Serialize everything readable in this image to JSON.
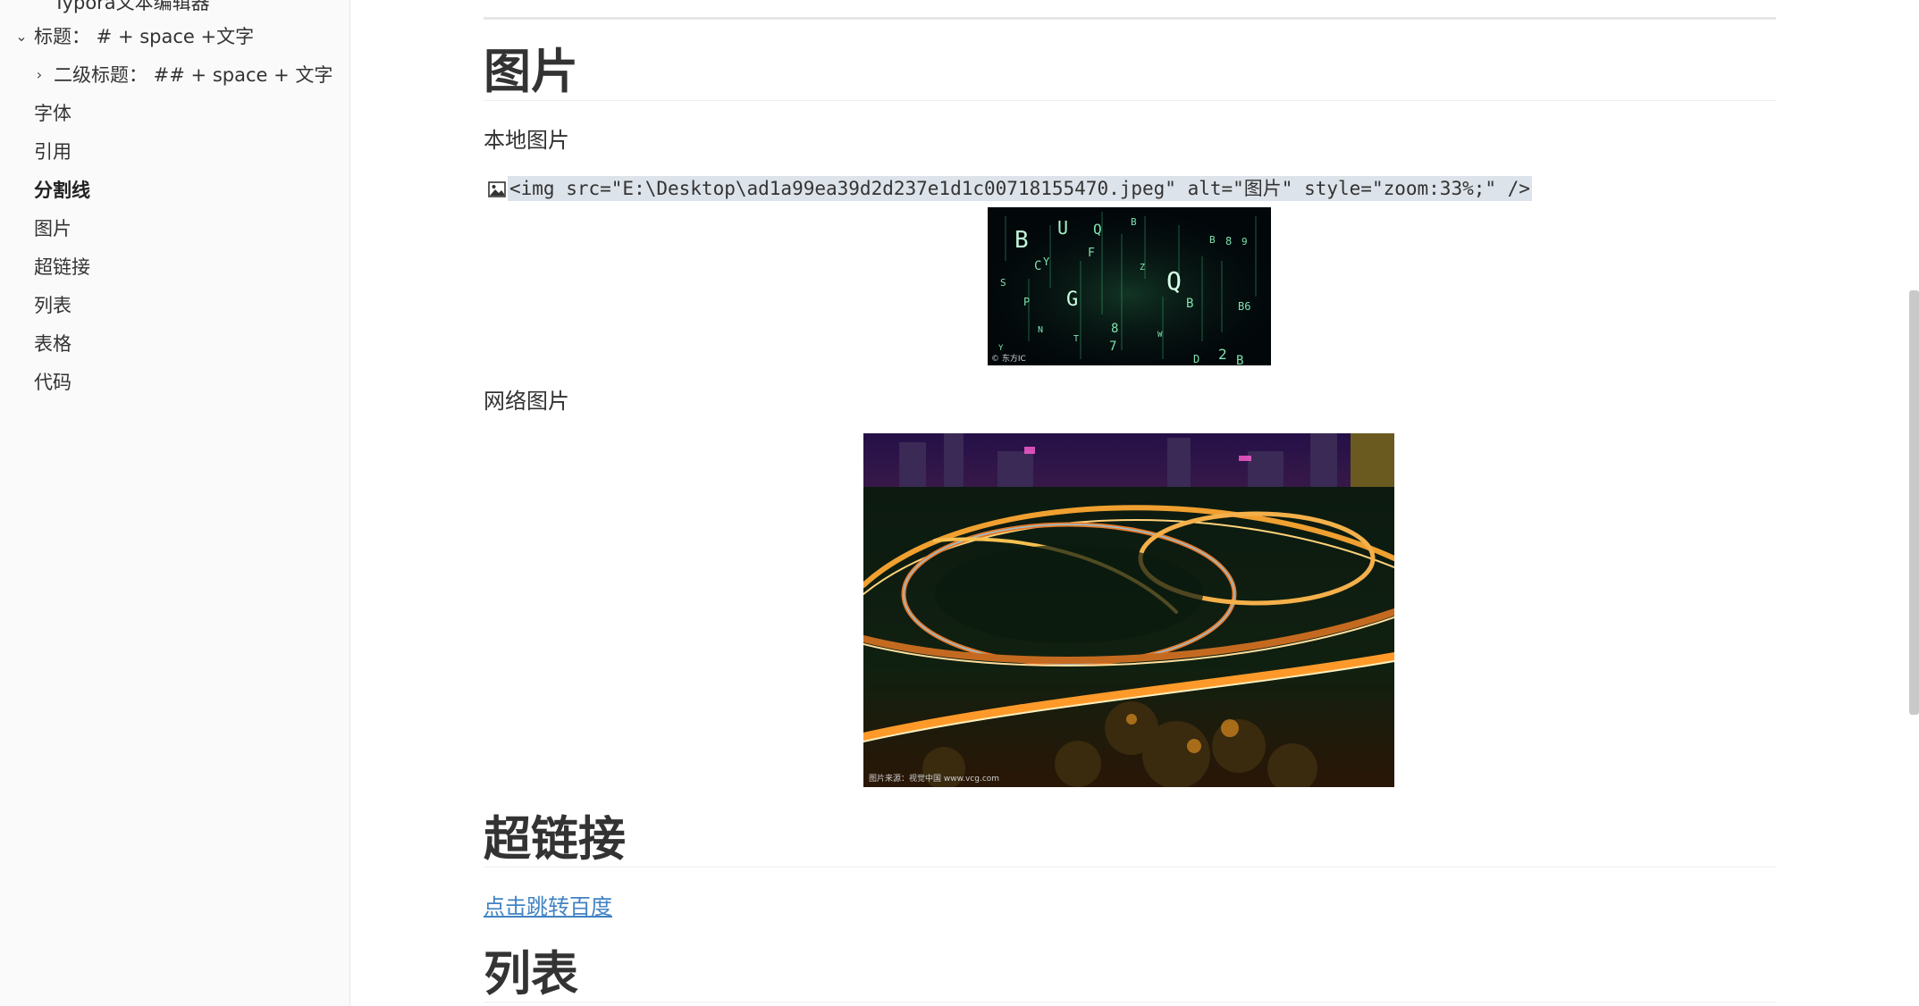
{
  "sidebar": {
    "items": [
      {
        "label": "Typora文本编辑器",
        "level": 2,
        "chevron": "",
        "active": false
      },
      {
        "label": "标题： # + space +文字",
        "level": 1,
        "chevron": "chevron-down-icon",
        "active": false
      },
      {
        "label": "二级标题： ## + space + 文字",
        "level": 2,
        "chevron": "chevron-right-icon",
        "active": false
      },
      {
        "label": "字体",
        "level": 1,
        "chevron": "",
        "active": false
      },
      {
        "label": "引用",
        "level": 1,
        "chevron": "",
        "active": false
      },
      {
        "label": "分割线",
        "level": 1,
        "chevron": "",
        "active": true
      },
      {
        "label": "图片",
        "level": 1,
        "chevron": "",
        "active": false
      },
      {
        "label": "超链接",
        "level": 1,
        "chevron": "",
        "active": false
      },
      {
        "label": "列表",
        "level": 1,
        "chevron": "",
        "active": false
      },
      {
        "label": "表格",
        "level": 1,
        "chevron": "",
        "active": false
      },
      {
        "label": "代码",
        "level": 1,
        "chevron": "",
        "active": false
      }
    ]
  },
  "doc": {
    "h_images": "图片",
    "local_image_label": "本地图片",
    "img_source": "<img src=\"E:\\Desktop\\ad1a99ea39d2d237e1d1c00718155470.jpeg\" alt=\"图片\" style=\"zoom:33%;\" />",
    "local_image_watermark": "© 东方IC",
    "web_image_label": "网络图片",
    "web_image_watermark": "图片来源：视觉中国 www.vcg.com",
    "h_links": "超链接",
    "link_text": "点击跳转百度",
    "h_lists": "列表"
  },
  "colors": {
    "link": "#4183c4",
    "code_highlight": "#dde3ea",
    "sidebar_bg": "#fafafa"
  }
}
